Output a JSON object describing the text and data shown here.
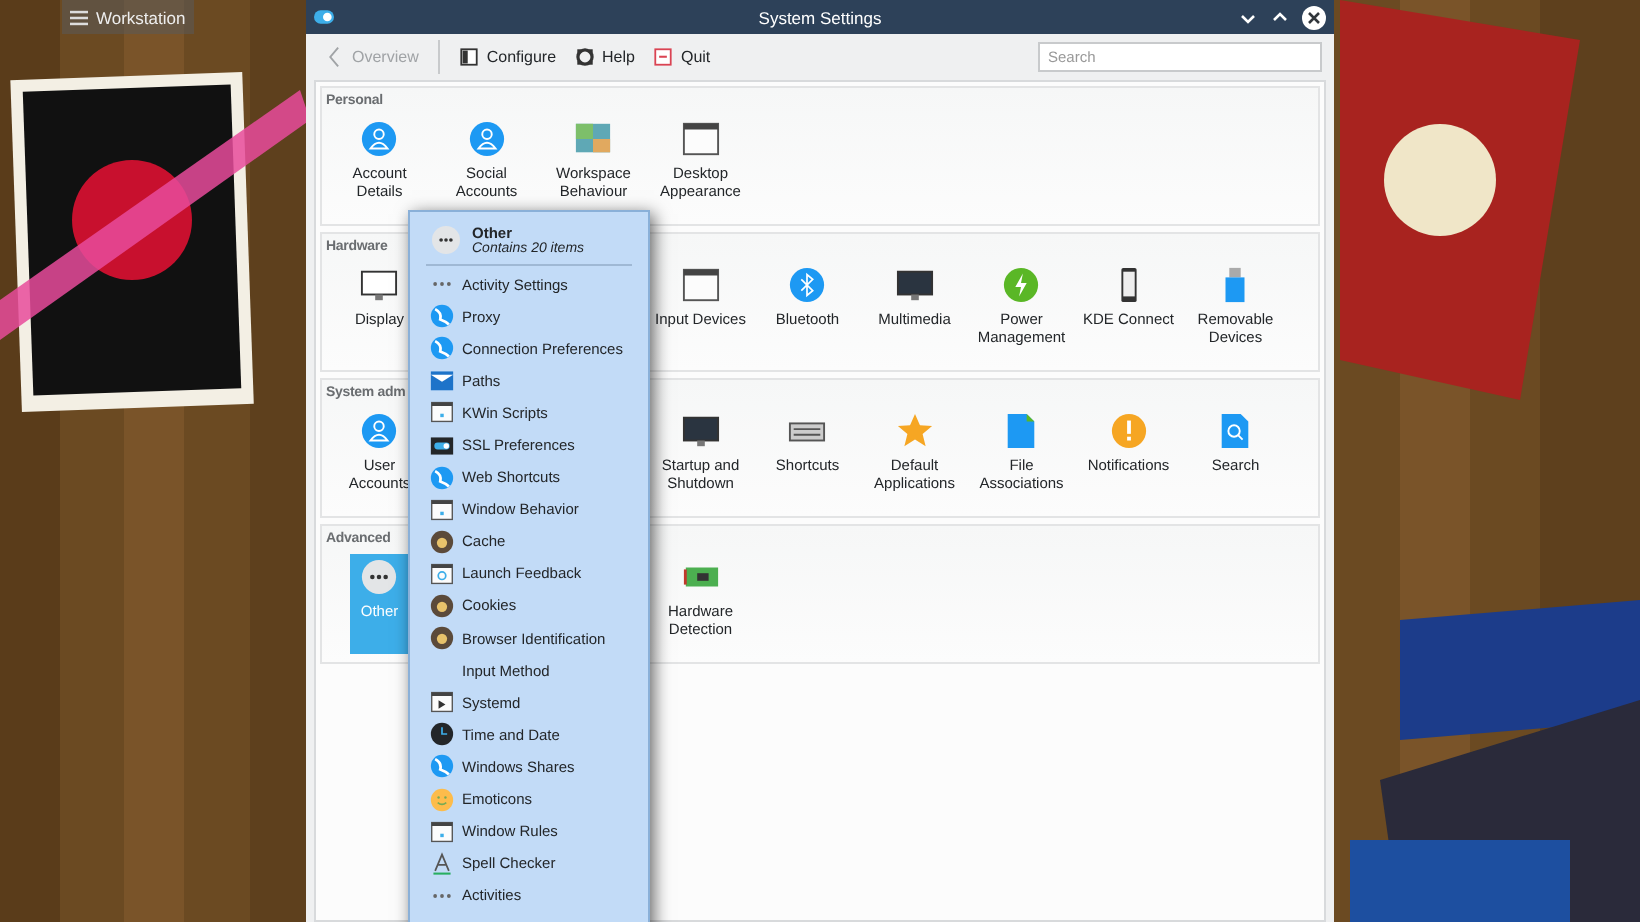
{
  "panel": {
    "label": "Workstation"
  },
  "window": {
    "title": "System Settings"
  },
  "toolbar": {
    "back": {
      "label": "Overview",
      "disabled": true
    },
    "actions": [
      "Configure",
      "Help",
      "Quit"
    ]
  },
  "search": {
    "placeholder": "Search"
  },
  "sections": [
    {
      "title": "Personal",
      "items": [
        {
          "label": "Account Details",
          "selected": false
        },
        {
          "label": "Social Accounts",
          "selected": false
        },
        {
          "label": "Workspace Behaviour",
          "selected": false
        },
        {
          "label": "Desktop Appearance",
          "selected": false
        }
      ]
    },
    {
      "title": "Hardware",
      "items": [
        {
          "label": "Display",
          "selected": false
        },
        {
          "label": "Input Devices",
          "selected": false
        },
        {
          "label": "Bluetooth",
          "selected": false
        },
        {
          "label": "Multimedia",
          "selected": false
        },
        {
          "label": "Power Management",
          "selected": false
        },
        {
          "label": "KDE Connect",
          "selected": false
        },
        {
          "label": "Removable Devices",
          "selected": false
        }
      ]
    },
    {
      "title": "System adm",
      "items": [
        {
          "label": "User Accounts",
          "selected": false
        },
        {
          "label": "Startup and Shutdown",
          "selected": false
        },
        {
          "label": "Shortcuts",
          "selected": false
        },
        {
          "label": "Default Applications",
          "selected": false
        },
        {
          "label": "File Associations",
          "selected": false
        },
        {
          "label": "Notifications",
          "selected": false
        },
        {
          "label": "Search",
          "selected": false
        }
      ]
    },
    {
      "title": "Advanced",
      "items": [
        {
          "label": "Other",
          "selected": true
        },
        {
          "label": "Hardware Detection",
          "selected": false
        }
      ]
    }
  ],
  "popup": {
    "title": "Other",
    "subtitle": "Contains 20 items",
    "items": [
      "Activity Settings",
      "Proxy",
      "Connection Preferences",
      "Paths",
      "KWin Scripts",
      "SSL Preferences",
      "Web Shortcuts",
      "Window Behavior",
      "Cache",
      "Launch Feedback",
      "Cookies",
      "Browser Identification",
      "Input Method",
      "Systemd",
      "Time and Date",
      "Windows Shares",
      "Emoticons",
      "Window Rules",
      "Spell Checker",
      "Activities"
    ]
  }
}
